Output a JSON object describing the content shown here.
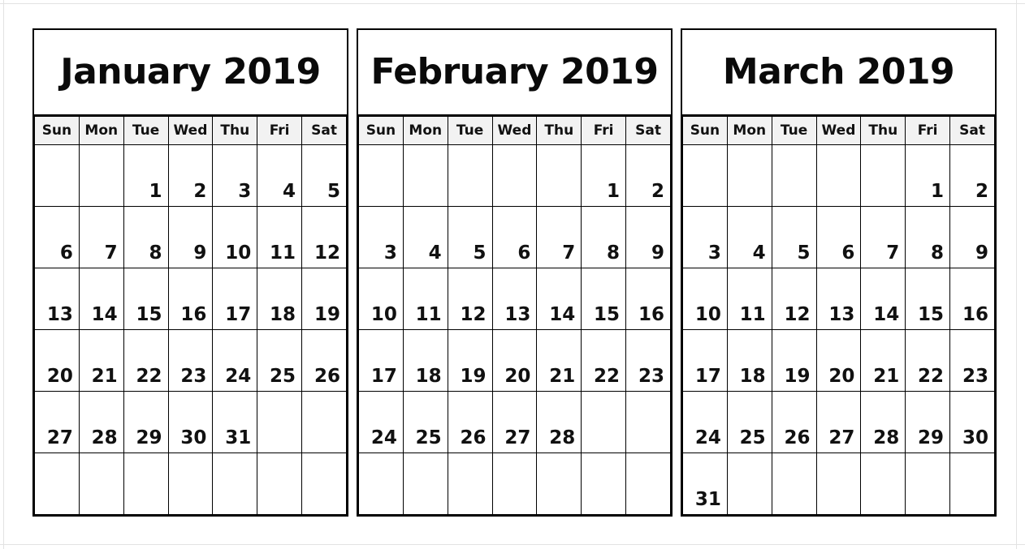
{
  "page": {
    "background_color": "#ffffff",
    "border_color": "#000000",
    "header_background_color": "#f2f2f2",
    "text_color": "#111111",
    "watermark_line1": "",
    "watermark_line2": ""
  },
  "weekday_headers": [
    "Sun",
    "Mon",
    "Tue",
    "Wed",
    "Thu",
    "Fri",
    "Sat"
  ],
  "calendars": [
    {
      "id": "january-2019",
      "title": "January 2019",
      "month": "January",
      "year": "2019",
      "weeks": [
        [
          "",
          "",
          "1",
          "2",
          "3",
          "4",
          "5"
        ],
        [
          "6",
          "7",
          "8",
          "9",
          "10",
          "11",
          "12"
        ],
        [
          "13",
          "14",
          "15",
          "16",
          "17",
          "18",
          "19"
        ],
        [
          "20",
          "21",
          "22",
          "23",
          "24",
          "25",
          "26"
        ],
        [
          "27",
          "28",
          "29",
          "30",
          "31",
          "",
          ""
        ],
        [
          "",
          "",
          "",
          "",
          "",
          "",
          ""
        ]
      ]
    },
    {
      "id": "february-2019",
      "title": "February 2019",
      "month": "February",
      "year": "2019",
      "weeks": [
        [
          "",
          "",
          "",
          "",
          "",
          "1",
          "2"
        ],
        [
          "3",
          "4",
          "5",
          "6",
          "7",
          "8",
          "9"
        ],
        [
          "10",
          "11",
          "12",
          "13",
          "14",
          "15",
          "16"
        ],
        [
          "17",
          "18",
          "19",
          "20",
          "21",
          "22",
          "23"
        ],
        [
          "24",
          "25",
          "26",
          "27",
          "28",
          "",
          ""
        ],
        [
          "",
          "",
          "",
          "",
          "",
          "",
          ""
        ]
      ]
    },
    {
      "id": "march-2019",
      "title": "March 2019",
      "month": "March",
      "year": "2019",
      "weeks": [
        [
          "",
          "",
          "",
          "",
          "",
          "1",
          "2"
        ],
        [
          "3",
          "4",
          "5",
          "6",
          "7",
          "8",
          "9"
        ],
        [
          "10",
          "11",
          "12",
          "13",
          "14",
          "15",
          "16"
        ],
        [
          "17",
          "18",
          "19",
          "20",
          "21",
          "22",
          "23"
        ],
        [
          "24",
          "25",
          "26",
          "27",
          "28",
          "29",
          "30"
        ],
        [
          "31",
          "",
          "",
          "",
          "",
          "",
          ""
        ]
      ]
    }
  ]
}
